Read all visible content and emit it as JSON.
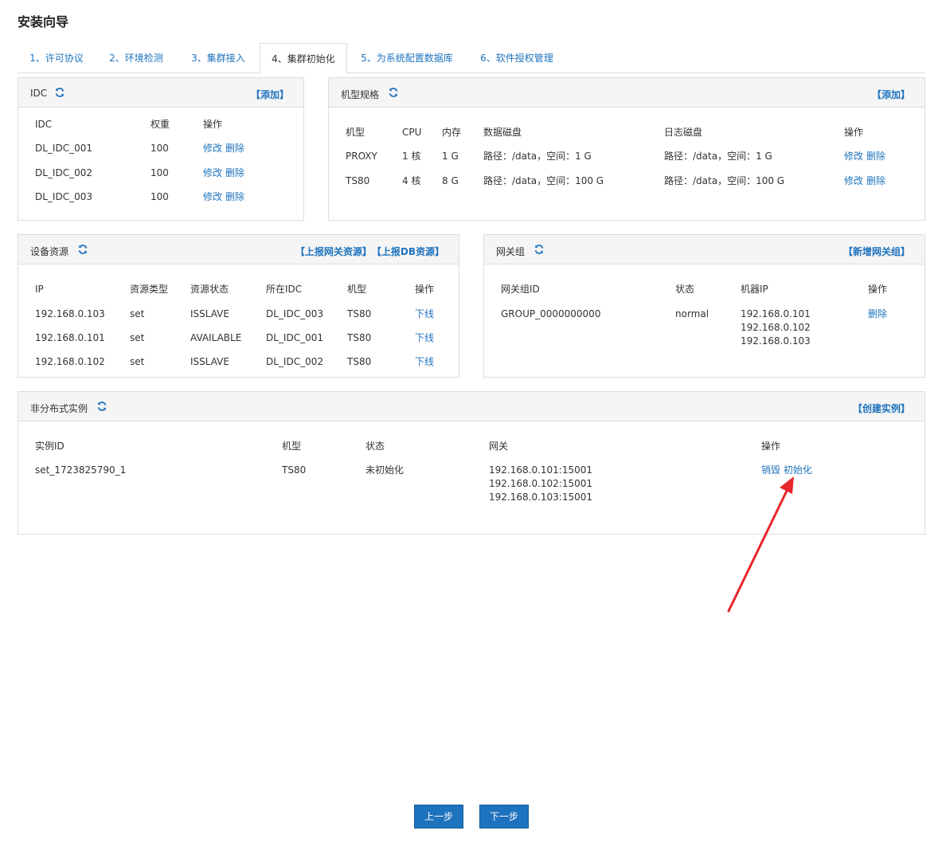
{
  "page": {
    "title": "安装向导"
  },
  "tabs": [
    {
      "label": "1、许可协议"
    },
    {
      "label": "2、环境检测"
    },
    {
      "label": "3、集群接入"
    },
    {
      "label": "4、集群初始化"
    },
    {
      "label": "5、为系统配置数据库"
    },
    {
      "label": "6、软件授权管理"
    }
  ],
  "idc": {
    "title": "IDC",
    "action": "【添加】",
    "headers": [
      "IDC",
      "权重",
      "操作"
    ],
    "rows": [
      {
        "name": "DL_IDC_001",
        "weight": "100",
        "edit": "修改",
        "del": "删除"
      },
      {
        "name": "DL_IDC_002",
        "weight": "100",
        "edit": "修改",
        "del": "删除"
      },
      {
        "name": "DL_IDC_003",
        "weight": "100",
        "edit": "修改",
        "del": "删除"
      }
    ]
  },
  "spec": {
    "title": "机型规格",
    "action": "【添加】",
    "headers": [
      "机型",
      "CPU",
      "内存",
      "数据磁盘",
      "日志磁盘",
      "操作"
    ],
    "rows": [
      {
        "model": "PROXY",
        "cpu": "1 核",
        "mem": "1 G",
        "data": "路径：/data，空间：1 G",
        "log": "路径：/data，空间：1 G",
        "edit": "修改",
        "del": "删除"
      },
      {
        "model": "TS80",
        "cpu": "4 核",
        "mem": "8 G",
        "data": "路径：/data，空间：100 G",
        "log": "路径：/data，空间：100 G",
        "edit": "修改",
        "del": "删除"
      }
    ]
  },
  "device": {
    "title": "设备资源",
    "action1": "【上报网关资源】",
    "action2": "【上报DB资源】",
    "headers": [
      "IP",
      "资源类型",
      "资源状态",
      "所在IDC",
      "机型",
      "操作"
    ],
    "rows": [
      {
        "ip": "192.168.0.103",
        "type": "set",
        "status": "ISSLAVE",
        "idc": "DL_IDC_003",
        "model": "TS80",
        "op": "下线"
      },
      {
        "ip": "192.168.0.101",
        "type": "set",
        "status": "AVAILABLE",
        "idc": "DL_IDC_001",
        "model": "TS80",
        "op": "下线"
      },
      {
        "ip": "192.168.0.102",
        "type": "set",
        "status": "ISSLAVE",
        "idc": "DL_IDC_002",
        "model": "TS80",
        "op": "下线"
      }
    ]
  },
  "gateway": {
    "title": "网关组",
    "action": "【新增网关组】",
    "headers": [
      "网关组ID",
      "状态",
      "机器IP",
      "操作"
    ],
    "rows": [
      {
        "id": "GROUP_0000000000",
        "status": "normal",
        "ips": [
          "192.168.0.101",
          "192.168.0.102",
          "192.168.0.103"
        ],
        "op": "删除"
      }
    ]
  },
  "instances": {
    "title": "非分布式实例",
    "action": "【创建实例】",
    "headers": [
      "实例ID",
      "机型",
      "状态",
      "网关",
      "操作"
    ],
    "rows": [
      {
        "id": "set_1723825790_1",
        "model": "TS80",
        "status": "未初始化",
        "gateways": [
          "192.168.0.101:15001",
          "192.168.0.102:15001",
          "192.168.0.103:15001"
        ],
        "destroy": "销毁",
        "init": "初始化"
      }
    ]
  },
  "footer": {
    "prev": "上一步",
    "next": "下一步"
  },
  "colors": {
    "link": "#1e73be",
    "button": "#1e73be",
    "annotation_arrow": "#e8262b"
  }
}
